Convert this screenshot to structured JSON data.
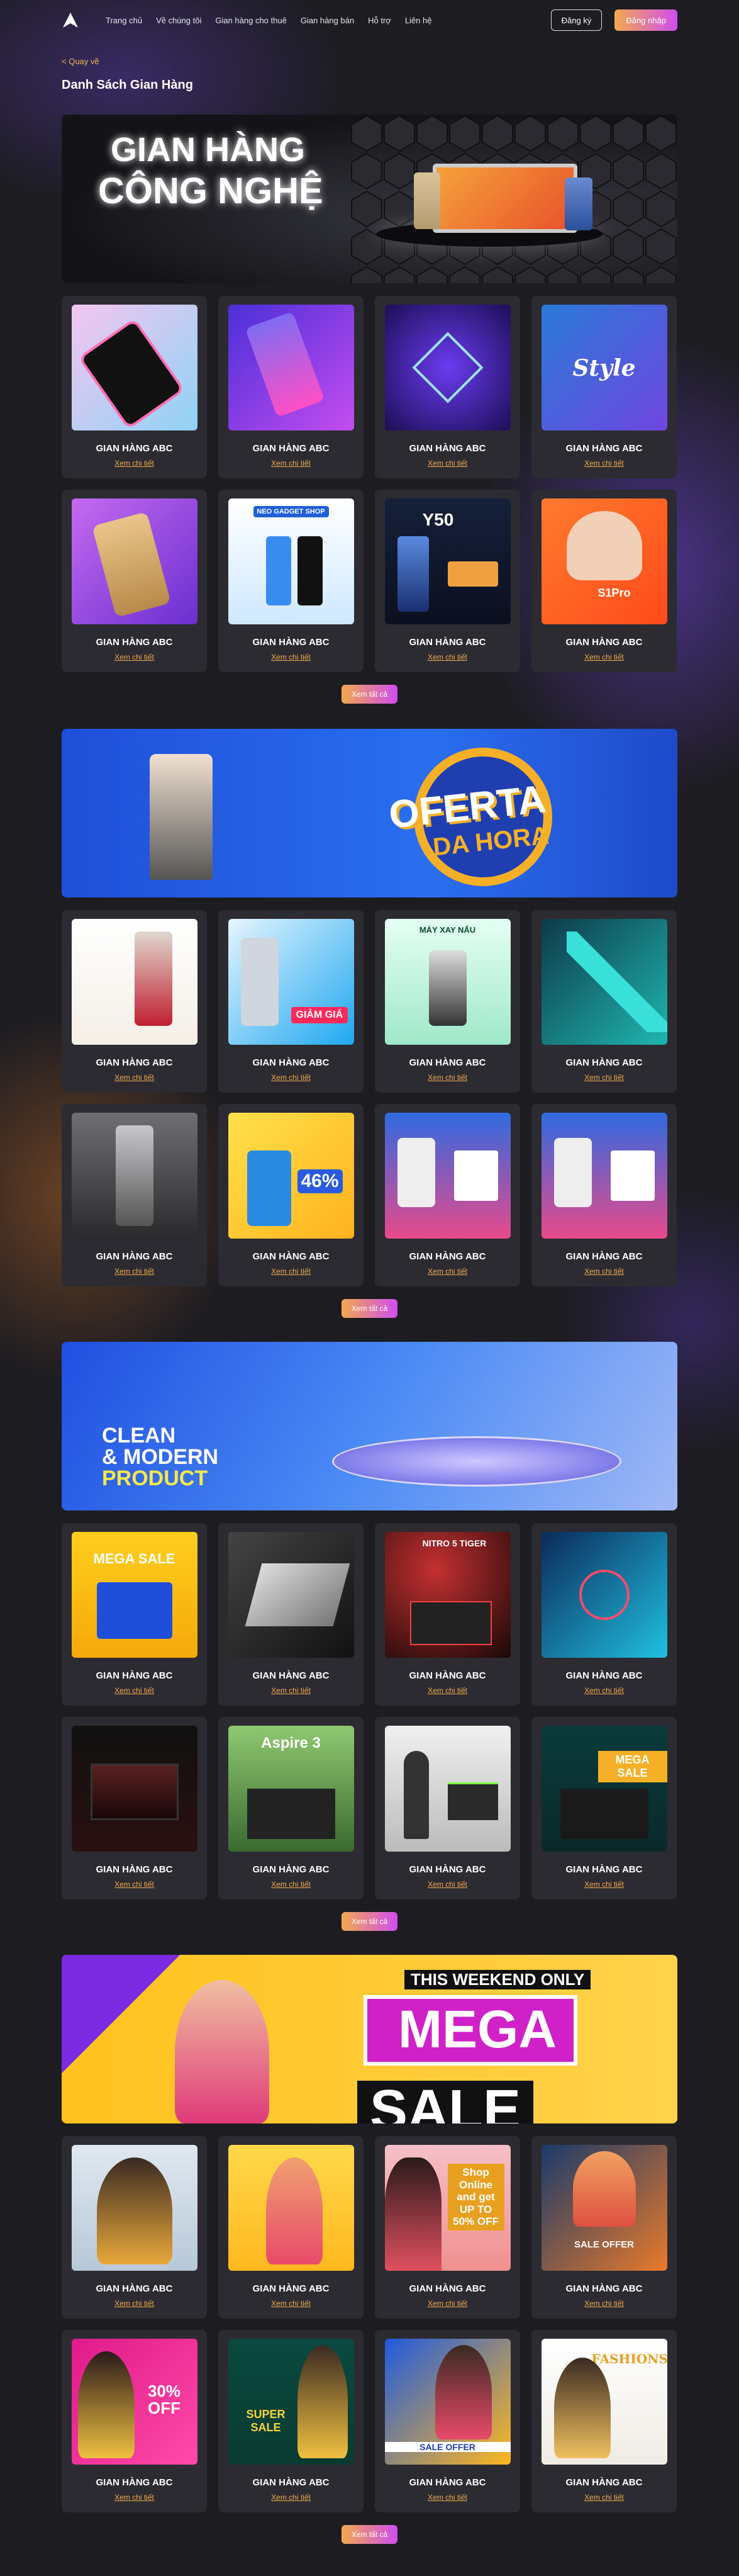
{
  "nav": {
    "links": [
      "Trang chủ",
      "Về chúng tôi",
      "Gian hàng cho thuê",
      "Gian hàng bán",
      "Hỗ trợ",
      "Liên hệ"
    ],
    "register": "Đăng ký",
    "login": "Đăng nhập"
  },
  "back": "< Quay về",
  "page_title": "Danh Sách Gian Hàng",
  "sections": [
    {
      "banner": {
        "line1": "GIAN HÀNG",
        "line2": "CÔNG NGHỆ"
      },
      "cards": [
        {
          "title": "GIAN HÀNG ABC",
          "link": "Xem chi tiết"
        },
        {
          "title": "GIAN HÀNG ABC",
          "link": "Xem chi tiết"
        },
        {
          "title": "GIAN HÀNG ABC",
          "link": "Xem chi tiết"
        },
        {
          "title": "GIAN HÀNG ABC",
          "link": "Xem chi tiết",
          "thumb_text": "Style"
        },
        {
          "title": "GIAN HÀNG ABC",
          "link": "Xem chi tiết"
        },
        {
          "title": "GIAN HÀNG ABC",
          "link": "Xem chi tiết",
          "thumb_text": "NEO GADGET SHOP"
        },
        {
          "title": "GIAN HÀNG ABC",
          "link": "Xem chi tiết",
          "thumb_text": "Y50"
        },
        {
          "title": "GIAN HÀNG ABC",
          "link": "Xem chi tiết",
          "thumb_text": "S1Pro"
        }
      ],
      "more": "Xem tất cả"
    },
    {
      "banner": {
        "line1": "OFERTA",
        "line2": "DA HORA"
      },
      "cards": [
        {
          "title": "GIAN HÀNG ABC",
          "link": "Xem chi tiết"
        },
        {
          "title": "GIAN HÀNG ABC",
          "link": "Xem chi tiết",
          "thumb_text": "GIẢM GIÁ"
        },
        {
          "title": "GIAN HÀNG ABC",
          "link": "Xem chi tiết",
          "thumb_text": "MÁY XAY NẤU"
        },
        {
          "title": "GIAN HÀNG ABC",
          "link": "Xem chi tiết"
        },
        {
          "title": "GIAN HÀNG ABC",
          "link": "Xem chi tiết"
        },
        {
          "title": "GIAN HÀNG ABC",
          "link": "Xem chi tiết",
          "thumb_text": "46%"
        },
        {
          "title": "GIAN HÀNG ABC",
          "link": "Xem chi tiết"
        },
        {
          "title": "GIAN HÀNG ABC",
          "link": "Xem chi tiết"
        }
      ],
      "more": "Xem tất cả"
    },
    {
      "banner": {
        "line1": "CLEAN",
        "line2": "& MODERN",
        "line3": "PRODUCT"
      },
      "cards": [
        {
          "title": "GIAN HÀNG ABC",
          "link": "Xem chi tiết",
          "thumb_text": "MEGA SALE"
        },
        {
          "title": "GIAN HÀNG ABC",
          "link": "Xem chi tiết"
        },
        {
          "title": "GIAN HÀNG ABC",
          "link": "Xem chi tiết",
          "thumb_text": "NITRO 5 TIGER"
        },
        {
          "title": "GIAN HÀNG ABC",
          "link": "Xem chi tiết"
        },
        {
          "title": "GIAN HÀNG ABC",
          "link": "Xem chi tiết"
        },
        {
          "title": "GIAN HÀNG ABC",
          "link": "Xem chi tiết",
          "thumb_text": "Aspire 3"
        },
        {
          "title": "GIAN HÀNG ABC",
          "link": "Xem chi tiết"
        },
        {
          "title": "GIAN HÀNG ABC",
          "link": "Xem chi tiết",
          "thumb_text": "MEGA SALE"
        }
      ],
      "more": "Xem tất cả"
    },
    {
      "banner": {
        "line1": "THIS WEEKEND ONLY",
        "line2": "MEGA",
        "line3": "SALE"
      },
      "cards": [
        {
          "title": "GIAN HÀNG ABC",
          "link": "Xem chi tiết"
        },
        {
          "title": "GIAN HÀNG ABC",
          "link": "Xem chi tiết"
        },
        {
          "title": "GIAN HÀNG ABC",
          "link": "Xem chi tiết",
          "thumb_text": "Shop Online and get UP TO 50% OFF"
        },
        {
          "title": "GIAN HÀNG ABC",
          "link": "Xem chi tiết",
          "thumb_text": "SALE OFFER"
        },
        {
          "title": "GIAN HÀNG ABC",
          "link": "Xem chi tiết",
          "thumb_text": "30% OFF"
        },
        {
          "title": "GIAN HÀNG ABC",
          "link": "Xem chi tiết",
          "thumb_text": "SUPER SALE"
        },
        {
          "title": "GIAN HÀNG ABC",
          "link": "Xem chi tiết",
          "thumb_text": "SALE OFFER"
        },
        {
          "title": "GIAN HÀNG ABC",
          "link": "Xem chi tiết",
          "thumb_text": "FASHIONS"
        }
      ],
      "more": "Xem tất cả"
    }
  ]
}
